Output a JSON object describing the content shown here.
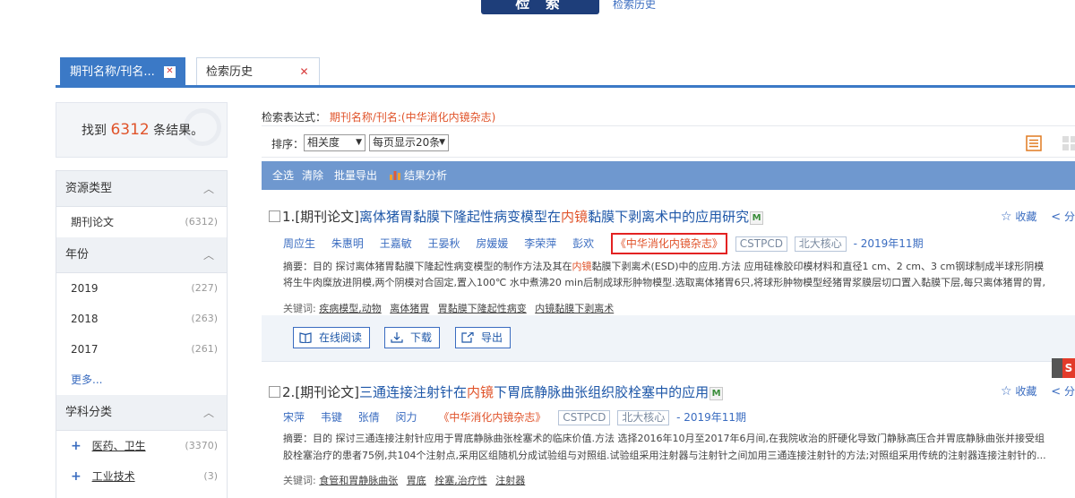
{
  "top": {
    "search_button_label": "检 索",
    "search_history_link": "检索历史"
  },
  "tabs": [
    {
      "label": "期刊名称/刊名...",
      "close": "✕"
    },
    {
      "label": "检索历史",
      "close": "✕"
    }
  ],
  "sidebar": {
    "found_prefix": "找到",
    "found_count": "6312",
    "found_suffix": "条结果。",
    "sections": {
      "resource_type": {
        "title": "资源类型",
        "items": [
          {
            "label": "期刊论文",
            "count": "(6312)"
          }
        ]
      },
      "year": {
        "title": "年份",
        "items": [
          {
            "label": "2019",
            "count": "(227)"
          },
          {
            "label": "2018",
            "count": "(263)"
          },
          {
            "label": "2017",
            "count": "(261)"
          }
        ],
        "more": "更多..."
      },
      "subject": {
        "title": "学科分类",
        "items": [
          {
            "label": "医药、卫生",
            "count": "(3370)"
          },
          {
            "label": "工业技术",
            "count": "(3)"
          }
        ]
      }
    }
  },
  "main": {
    "expr_label": "检索表达式：",
    "expr_value": "期刊名称/刊名:(中华消化内镜杂志)",
    "sort_label": "排序：",
    "sort_value": "相关度",
    "per_page_value": "每页显示20条",
    "toolbar": {
      "select_all": "全选",
      "clear": "清除",
      "batch_export": "批量导出",
      "analysis": "结果分析"
    }
  },
  "results": [
    {
      "index": "1.",
      "type": "[期刊论文]",
      "title_a": "离体猪胃黏膜下隆起性病变模型在",
      "title_hl": "内镜",
      "title_b": "黏膜下剥离术中的应用研究",
      "m": "M",
      "favorite": "收藏",
      "share": "分",
      "authors": [
        "周应生",
        "朱惠明",
        "王嘉敏",
        "王晏秋",
        "房媛媛",
        "李荣萍",
        "彭欢"
      ],
      "journal": "《中华消化内镜杂志》",
      "tags": [
        "CSTPCD",
        "北大核心"
      ],
      "year": "- 2019年11期",
      "abstract_1a": "摘要：目的 探讨离体猪胃黏膜下隆起性病变模型的制作方法及其在",
      "abstract_1hl": "内镜",
      "abstract_1b": "黏膜下剥离术(ESD)中的应用.方法 应用硅橡胶印模材料和直径1 cm、2 cm、3 cm钢球制成半球形阴模",
      "abstract_2": "将生牛肉糜放进阴模,两个阴模对合固定,置入100℃ 水中煮沸20 min后制成球形肿物模型.选取离体猪胃6只,将球形肿物模型经猪胃浆膜层切口置入黏膜下层,每只离体猪胃的胃,",
      "kw_label": "关键词:",
      "keywords": [
        "疾病模型,动物",
        "离体猪胃",
        "胃黏膜下隆起性病变",
        "内镜黏膜下剥离术"
      ],
      "btn_read": "在线阅读",
      "btn_download": "下载",
      "btn_export": "导出"
    },
    {
      "index": "2.",
      "type": "[期刊论文]",
      "title_a": "三通连接注射针在",
      "title_hl": "内镜",
      "title_b": "下胃底静脉曲张组织胶栓塞中的应用",
      "m": "M",
      "favorite": "收藏",
      "share": "分",
      "authors": [
        "宋萍",
        "韦键",
        "张倩",
        "闵力"
      ],
      "journal": "《中华消化内镜杂志》",
      "tags": [
        "CSTPCD",
        "北大核心"
      ],
      "year": "- 2019年11期",
      "abstract_1a": "摘要：目的 探讨三通连接注射针应用于胃底静脉曲张栓塞术的临床价值.方法 选择2016年10月至2017年6月间,在我院收治的肝硬化导致门静脉高压合并胃底静脉曲张并接受组",
      "abstract_2": "胶栓塞治疗的患者75例,共104个注射点,采用区组随机分成试验组与对照组.试验组采用注射器与注射针之间加用三通连接注射针的方法;对照组采用传统的注射器连接注射针的...",
      "kw_label": "关键词:",
      "keywords": [
        "食管和胃静脉曲张",
        "胃底",
        "栓塞,治疗性",
        "注射器"
      ]
    }
  ],
  "widget_letter": "S"
}
